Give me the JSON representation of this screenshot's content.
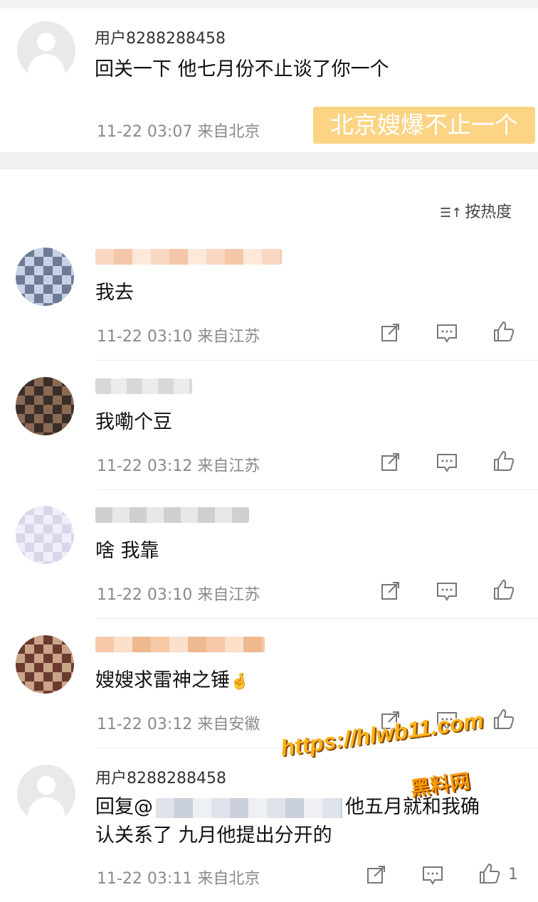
{
  "top_comment": {
    "username": "用户8288288458",
    "text": "回关一下 他七月份不止谈了你一个",
    "time_location": "11-22 03:07 来自北京",
    "highlight_tag": "北京嫂爆不止一个"
  },
  "sort": {
    "icon": "sort-icon",
    "label": "按热度"
  },
  "comments": [
    {
      "text": "我去",
      "time_location": "11-22 03:10 来自江苏"
    },
    {
      "text": "我嘞个豆",
      "time_location": "11-22 03:12 来自江苏"
    },
    {
      "text": "啥 我靠",
      "time_location": "11-22 03:10 来自江苏"
    },
    {
      "text": "嫂嫂求雷神之锤",
      "emoji": "🤞",
      "time_location": "11-22 03:12 来自安徽"
    }
  ],
  "reply": {
    "username": "用户8288288458",
    "prefix": "回复@",
    "text_after_mention": "他五月就和我确",
    "text_line2": "认关系了 九月他提出分开的",
    "time_location": "11-22 03:11 来自北京",
    "like_count": "1"
  },
  "watermark": {
    "url": "https://hlwb11.com",
    "site": "黑料网"
  },
  "icons": {
    "share": "share-icon",
    "comment": "comment-icon",
    "like": "like-icon"
  },
  "colors": {
    "tag_bg": "#fcd484",
    "meta": "#8a8a8a",
    "separator": "#f0f0f0"
  }
}
